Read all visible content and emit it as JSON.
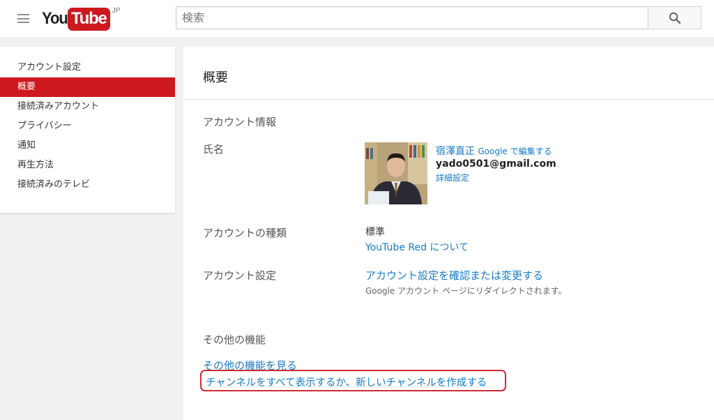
{
  "header": {
    "logo_you": "You",
    "logo_tube": "Tube",
    "logo_region": "JP",
    "search_placeholder": "検索"
  },
  "sidebar": {
    "items": [
      {
        "label": "アカウント設定"
      },
      {
        "label": "概要"
      },
      {
        "label": "接続済みアカウント"
      },
      {
        "label": "プライバシー"
      },
      {
        "label": "通知"
      },
      {
        "label": "再生方法"
      },
      {
        "label": "接続済みのテレビ"
      }
    ],
    "active_index": 1
  },
  "main": {
    "title": "概要",
    "account_info": {
      "heading": "アカウント情報",
      "name_label": "氏名",
      "name": "宿澤直正",
      "edit_link": "Google で編集する",
      "email": "yado0501@gmail.com",
      "details_link": "詳細設定"
    },
    "account_type": {
      "label": "アカウントの種類",
      "value": "標準",
      "link": "YouTube Red について"
    },
    "account_settings": {
      "label": "アカウント設定",
      "link": "アカウント設定を確認または変更する",
      "note": "Google アカウント ページにリダイレクトされます。"
    },
    "other_features": {
      "heading": "その他の機能",
      "more_link": "その他の機能を見る",
      "channel_link": "チャンネルをすべて表示するか、新しいチャンネルを作成する"
    }
  },
  "colors": {
    "brand_red": "#cc181e",
    "link_blue": "#167ac6",
    "highlight_border": "#cc2a36"
  }
}
